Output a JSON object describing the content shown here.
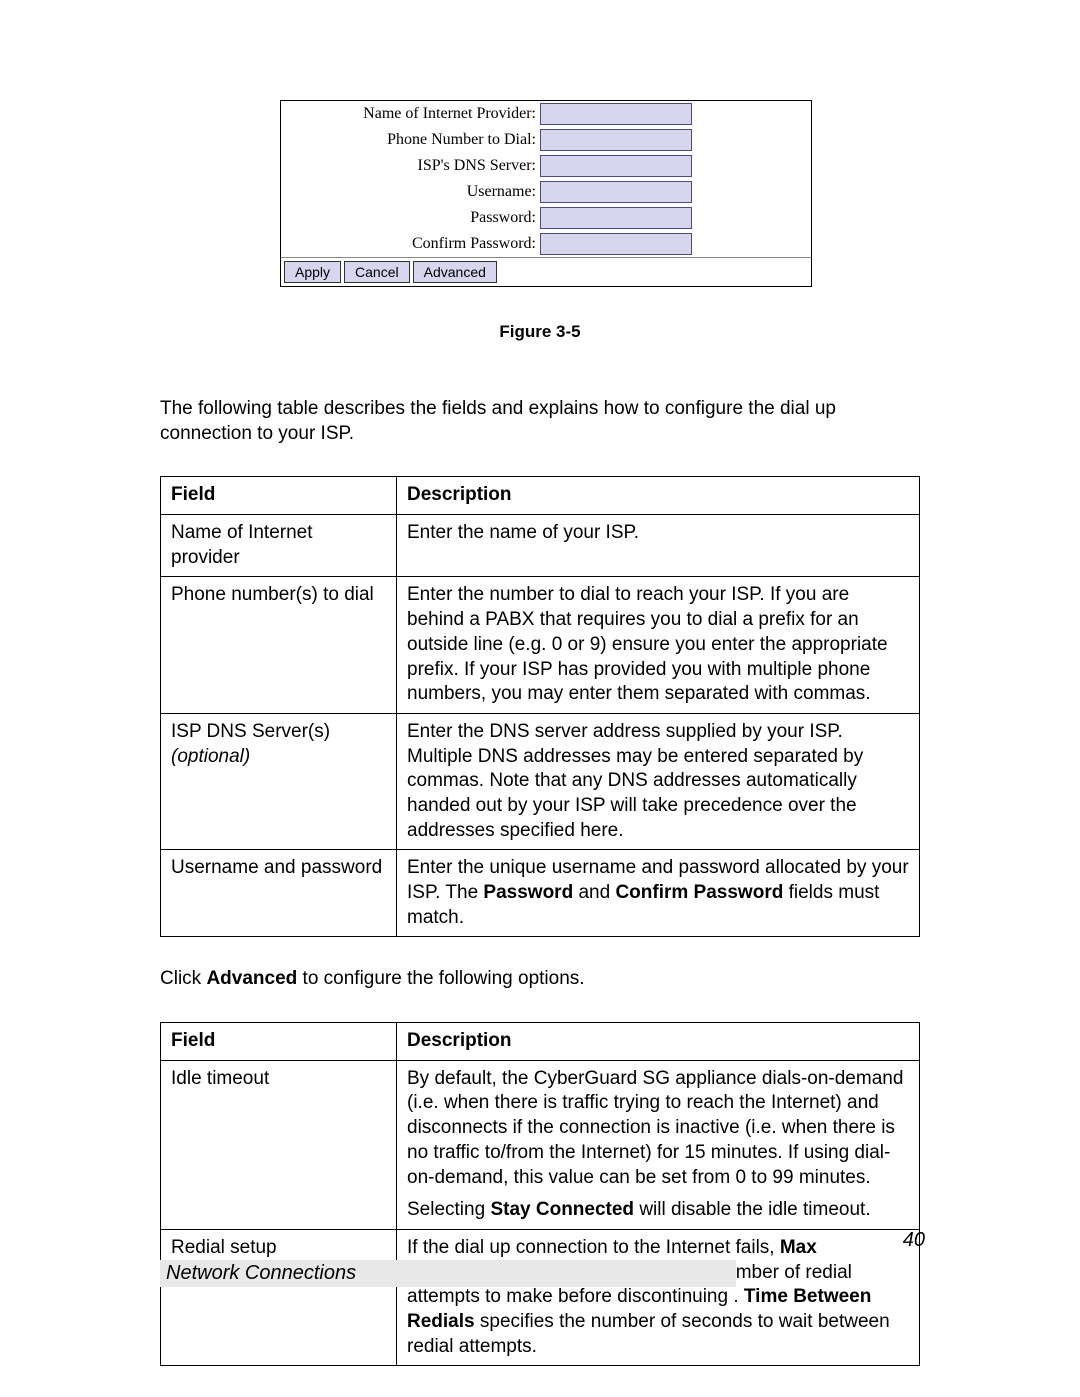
{
  "form": {
    "labels": {
      "provider": "Name of Internet Provider:",
      "phone": "Phone Number to Dial:",
      "dns": "ISP's DNS Server:",
      "user": "Username:",
      "pass": "Password:",
      "confirm": "Confirm Password:"
    },
    "buttons": {
      "apply": "Apply",
      "cancel": "Cancel",
      "advanced": "Advanced"
    }
  },
  "caption": "Figure 3-5",
  "intro": "The following table describes the fields and explains how to configure the dial up connection to your ISP.",
  "table1": {
    "h1": "Field",
    "h2": "Description",
    "rows": [
      {
        "field": "Name of Internet provider",
        "desc": "Enter the name of your ISP."
      },
      {
        "field": "Phone number(s) to dial",
        "desc": "Enter the number to dial to reach your ISP.  If you are behind a PABX that requires you to dial a prefix for an outside line (e.g.  0 or 9) ensure you enter the appropriate prefix.  If your ISP has provided you with multiple phone numbers, you may enter them separated with commas."
      },
      {
        "field_main": "ISP DNS Server(s)",
        "field_note": "(optional)",
        "desc": "Enter the DNS server address supplied by your ISP. Multiple DNS addresses may be entered separated by commas.  Note that any DNS addresses automatically handed out by your ISP will take precedence over the addresses specified here."
      },
      {
        "field": "Username and password",
        "desc_pre": "Enter the unique username and password allocated by your ISP.  The ",
        "desc_b1": "Password",
        "desc_mid": " and ",
        "desc_b2": "Confirm Password",
        "desc_post": " fields must match."
      }
    ]
  },
  "advanced_intro_pre": "Click ",
  "advanced_intro_b": "Advanced",
  "advanced_intro_post": " to configure the following options.",
  "table2": {
    "h1": "Field",
    "h2": "Description",
    "rows": [
      {
        "field": "Idle timeout",
        "p1": "By default, the CyberGuard SG appliance dials-on-demand (i.e.  when there is traffic trying to reach the Internet) and disconnects if the connection is inactive (i.e.  when there is no traffic to/from the Internet) for 15 minutes.  If using dial-on-demand, this value can be set from 0 to 99 minutes.",
        "p2_pre": "Selecting ",
        "p2_b": "Stay Connected",
        "p2_post": " will disable the idle timeout."
      },
      {
        "field": "Redial setup",
        "pre": "If the dial up connection to the Internet fails, ",
        "b1": "Max Connection Attempts",
        "mid1": " specifies  the number of redial attempts to make before discontinuing .  ",
        "b2": "Time Between Redials",
        "post": " specifies the number of seconds to wait between redial attempts."
      }
    ]
  },
  "page_number": "40",
  "footer": "Network Connections"
}
